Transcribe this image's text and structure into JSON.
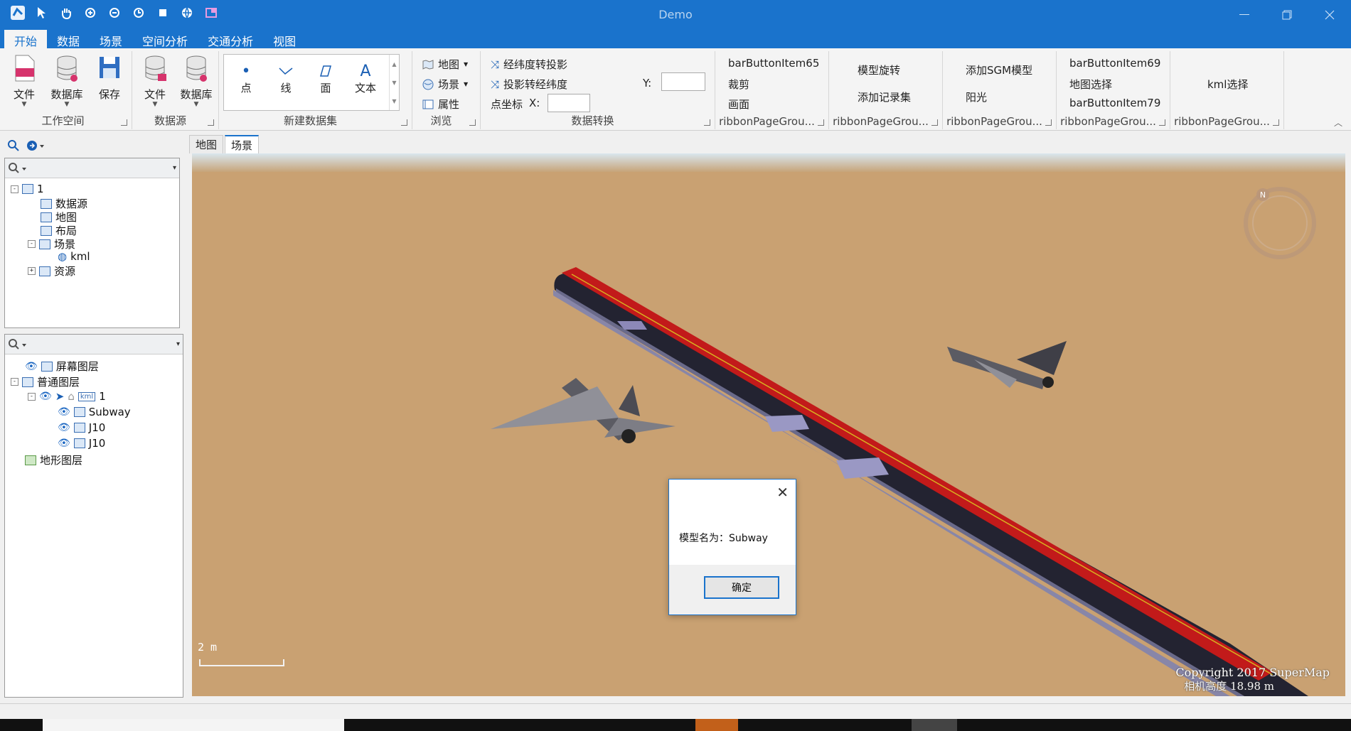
{
  "window": {
    "title": "Demo",
    "quick_access": [
      "app-icon",
      "select-icon",
      "pan-icon",
      "zoom-in-icon",
      "zoom-out-icon",
      "refresh-icon",
      "stop-icon",
      "globe-icon",
      "layout-icon"
    ]
  },
  "ribbon_tabs": [
    {
      "label": "开始",
      "active": true
    },
    {
      "label": "数据"
    },
    {
      "label": "场景"
    },
    {
      "label": "空间分析"
    },
    {
      "label": "交通分析"
    },
    {
      "label": "视图"
    }
  ],
  "groups": {
    "workspace": {
      "label": "工作空间",
      "file": "文件",
      "database": "数据库",
      "save": "保存"
    },
    "datasource": {
      "label": "数据源",
      "file": "文件",
      "database": "数据库"
    },
    "new_dataset": {
      "label": "新建数据集",
      "point": "点",
      "line": "线",
      "region": "面",
      "text": "文本"
    },
    "browse": {
      "label": "浏览",
      "map": "地图",
      "scene": "场景",
      "property": "属性"
    },
    "convert": {
      "label": "数据转换",
      "latlon_to_proj": "经纬度转投影",
      "proj_to_latlon": "投影转经纬度",
      "point_coord": "点坐标",
      "x_label": "X:",
      "y_label": "Y:",
      "x_value": "",
      "y_value": ""
    },
    "g65": {
      "label": "ribbonPageGrou...",
      "item1": "barButtonItem65",
      "item2": "裁剪",
      "item3": "画面"
    },
    "g_model": {
      "label": "ribbonPageGrou...",
      "item1": "模型旋转",
      "item2": "添加记录集"
    },
    "g_sgm": {
      "label": "ribbonPageGrou...",
      "item1": "添加SGM模型",
      "item2": "阳光"
    },
    "g69": {
      "label": "ribbonPageGrou...",
      "item1": "barButtonItem69",
      "item2": "地图选择",
      "item3": "barButtonItem79"
    },
    "g_kml": {
      "label": "ribbonPageGrou...",
      "item1": "kml选择"
    }
  },
  "workspace_tree": [
    {
      "label": "1",
      "expander": "-"
    },
    {
      "label": "数据源"
    },
    {
      "label": "地图"
    },
    {
      "label": "布局"
    },
    {
      "label": "场景",
      "expander": "-"
    },
    {
      "label": "kml"
    },
    {
      "label": "资源",
      "expander": "+"
    }
  ],
  "layer_tree": [
    {
      "label": "屏幕图层"
    },
    {
      "label": "普通图层",
      "expander": "-"
    },
    {
      "label": "1",
      "expander": "-",
      "badge": "kml"
    },
    {
      "label": "Subway"
    },
    {
      "label": "J10"
    },
    {
      "label": "J10"
    },
    {
      "label": "地形图层"
    }
  ],
  "view_tabs": [
    {
      "label": "地图"
    },
    {
      "label": "场景",
      "active": true
    }
  ],
  "scene": {
    "scale_label": "2 m",
    "copyright": "Copyright 2017 SuperMap",
    "camera_altitude": "相机高度 18.98 m",
    "compass_letter": "N"
  },
  "dialog": {
    "message": "模型名为：Subway",
    "ok_label": "确定"
  },
  "colors": {
    "accent": "#1a73cc",
    "ground": "#c9a172",
    "train_red": "#c21a1a"
  }
}
